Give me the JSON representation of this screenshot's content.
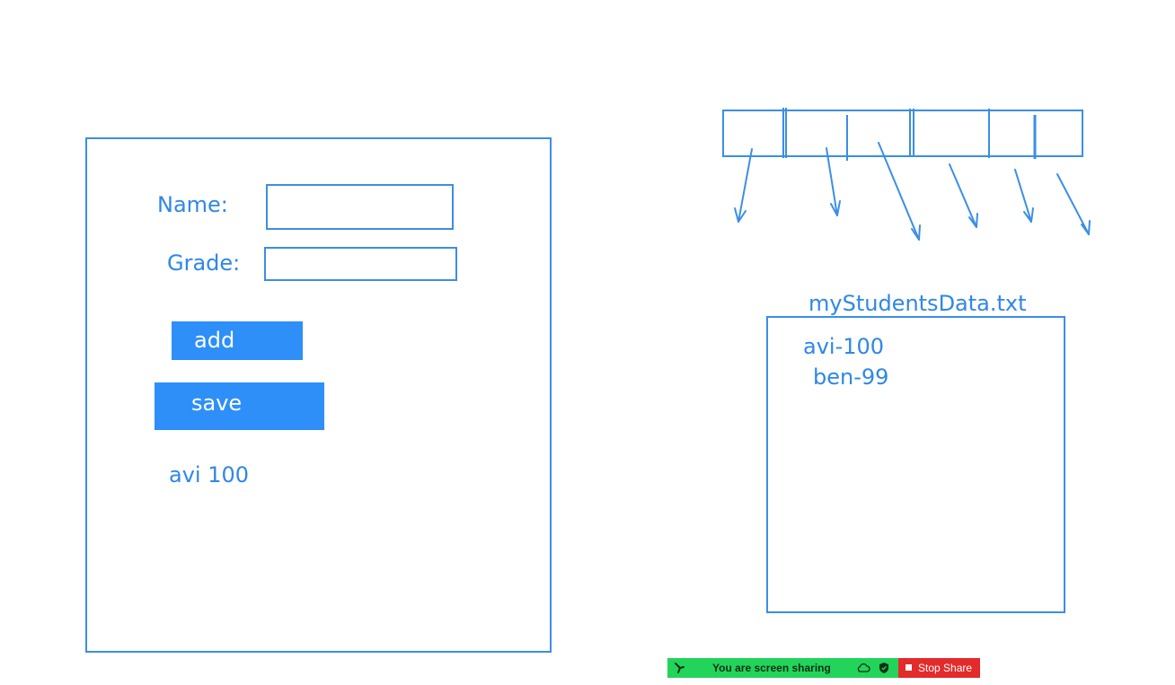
{
  "form": {
    "name_label": "Name:",
    "name_value": "",
    "grade_label": "Grade:",
    "grade_value": "",
    "add_label": "add",
    "save_label": "save",
    "output_text": "avi 100"
  },
  "file": {
    "title": "myStudentsData.txt",
    "lines": [
      "avi-100",
      "ben-99"
    ]
  },
  "share_bar": {
    "status": "You are screen sharing",
    "stop_label": "Stop Share",
    "icons": {
      "grip": "drag-handle-icon",
      "cloud": "cloud-icon",
      "shield": "shield-icon",
      "stop": "stop-square-icon"
    }
  },
  "colors": {
    "accent": "#2e8ff8",
    "stroke": "#3b8ee6",
    "share_green": "#23d45a",
    "share_red": "#e32b2b"
  }
}
